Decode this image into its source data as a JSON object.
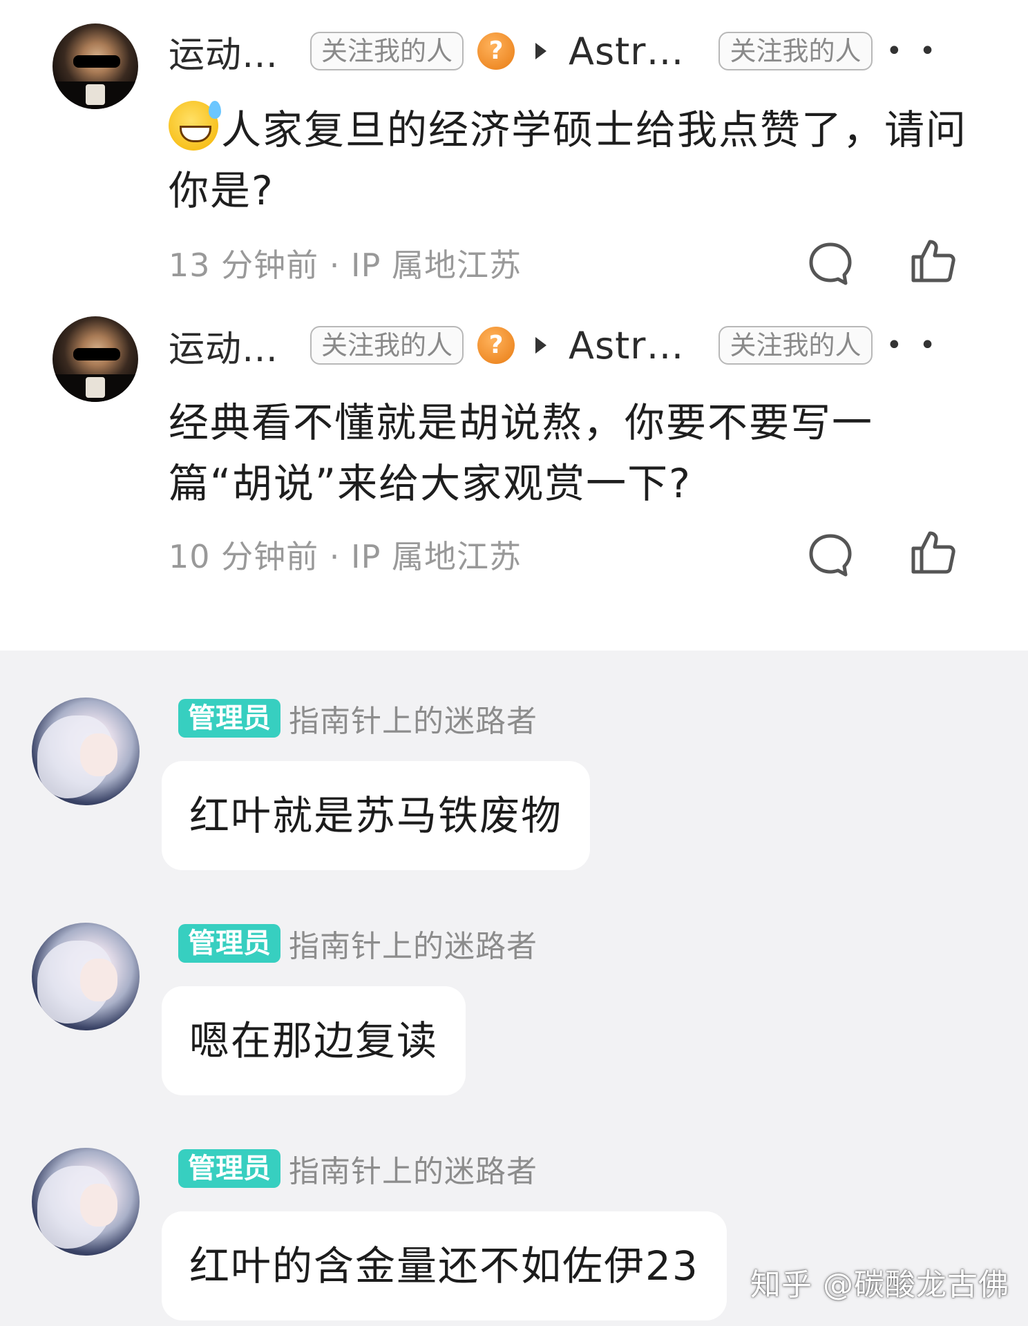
{
  "comments": [
    {
      "username": "运动…",
      "tag1": "关注我的人",
      "reply_to": "Astr…",
      "tag2": "关注我的人",
      "more": "• •",
      "text": "人家复旦的经济学硕士给我点赞了，请问你是?",
      "emoji_icon": "sweat-smile-emoji",
      "meta": "13 分钟前 · IP 属地江苏"
    },
    {
      "username": "运动…",
      "tag1": "关注我的人",
      "reply_to": "Astr…",
      "tag2": "关注我的人",
      "more": "• •",
      "text": "经典看不懂就是胡说熬，你要不要写一篇“胡说”来给大家观赏一下?",
      "meta": "10 分钟前 · IP 属地江苏"
    }
  ],
  "chat": [
    {
      "badge": "管理员",
      "name": "指南针上的迷路者",
      "message": "红叶就是苏马铁废物"
    },
    {
      "badge": "管理员",
      "name": "指南针上的迷路者",
      "message": "嗯在那边复读"
    },
    {
      "badge": "管理员",
      "name": "指南针上的迷路者",
      "message": "红叶的含金量还不如佐伊23"
    }
  ],
  "watermark": "知乎 @碳酸龙古佛",
  "colors": {
    "admin_badge": "#37cfc0",
    "chat_bg": "#f2f2f4",
    "question_icon": "#e87c14"
  }
}
